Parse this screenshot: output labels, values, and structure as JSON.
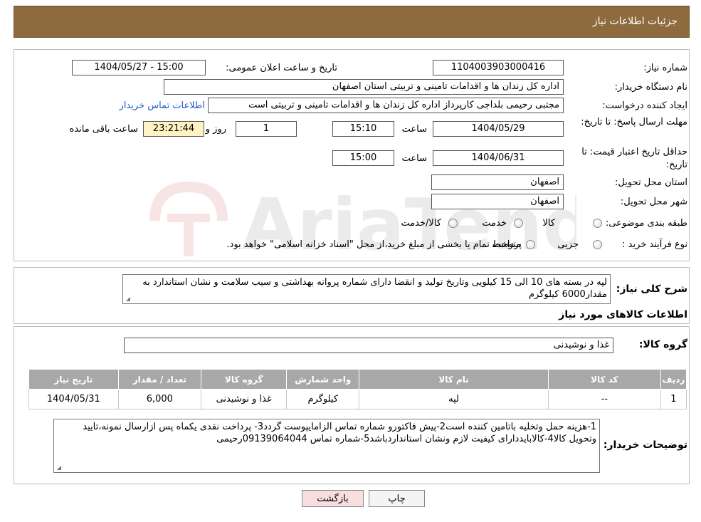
{
  "header": {
    "title": "جزئیات اطلاعات نیاز"
  },
  "form": {
    "need_number_label": "شماره نیاز:",
    "need_number": "1104003903000416",
    "announce_label": "تاریخ و ساعت اعلان عمومی:",
    "announce_value": "1404/05/27 - 15:00",
    "buyer_label": "نام دستگاه خریدار:",
    "buyer_value": "اداره کل زندان ها و اقدامات تامینی و تربیتی استان اصفهان",
    "creator_label": "ایجاد کننده درخواست:",
    "creator_value": "مجتبی رحیمی بلداجی کارپرداز اداره کل زندان ها و اقدامات تامینی و تربیتی است",
    "contact_link": "اطلاعات تماس خریدار",
    "reply_deadline_label": "مهلت ارسال پاسخ: تا تاریخ:",
    "reply_date": "1404/05/29",
    "time_label": "ساعت",
    "reply_time": "15:10",
    "days_value": "1",
    "days_label": "روز و",
    "remaining_time": "23:21:44",
    "remaining_label": "ساعت باقی مانده",
    "price_valid_label": "حداقل تاریخ اعتبار قیمت: تا تاریخ:",
    "price_valid_date": "1404/06/31",
    "price_valid_time": "15:00",
    "province_label": "استان محل تحویل:",
    "province_value": "اصفهان",
    "city_label": "شهر محل تحویل:",
    "city_value": "اصفهان",
    "category_label": "طبقه بندی موضوعی:",
    "category_options": [
      "کالا",
      "خدمت",
      "کالا/خدمت"
    ],
    "process_label": "نوع فرآیند خرید :",
    "process_options": [
      "جزیی",
      "متوسط"
    ],
    "process_note": "پرداخت تمام یا بخشی از مبلغ خرید،از محل \"اسناد خزانه اسلامی\" خواهد بود."
  },
  "summary": {
    "label": "شرح کلی نیاز:",
    "value": "لپه در بسته های 10 الی 15  کیلویی وتاریخ تولید و انقضا  دارای شماره پروانه بهداشتی و سیب سلامت و نشان استاندارد به مقدار6000 کیلوگرم"
  },
  "goods": {
    "section_title": "اطلاعات کالاهای مورد نیاز",
    "group_label": "گروه کالا:",
    "group_value": "غذا و نوشیدنی",
    "columns": [
      "ردیف",
      "کد کالا",
      "نام کالا",
      "واحد شمارش",
      "گروه کالا",
      "تعداد / مقدار",
      "تاریخ نیاز"
    ],
    "rows": [
      [
        "1",
        "--",
        "لپه",
        "کیلوگرم",
        "غذا و نوشیدنی",
        "6,000",
        "1404/05/31"
      ]
    ]
  },
  "buyer_notes": {
    "label": "توضیحات خریدار:",
    "value": "1-هزینه حمل وتخلیه باتامین کننده است2-پیش فاکتورو شماره تماس الزامایپوست گردد3- پرداخت نقدی یکماه  پس ازارسال نمونه،تایید وتحویل کالا4-کالابایددارای کیفیت لازم ونشان استانداردباشد5-شماره تماس 09139064044رحیمی"
  },
  "buttons": {
    "print": "چاپ",
    "back": "بازگشت"
  },
  "colors": {
    "header_bg": "#8e6b3e",
    "table_header_bg": "#a8a8a8",
    "remaining_bg": "#fff3c4",
    "back_btn_bg": "#f8dede"
  }
}
